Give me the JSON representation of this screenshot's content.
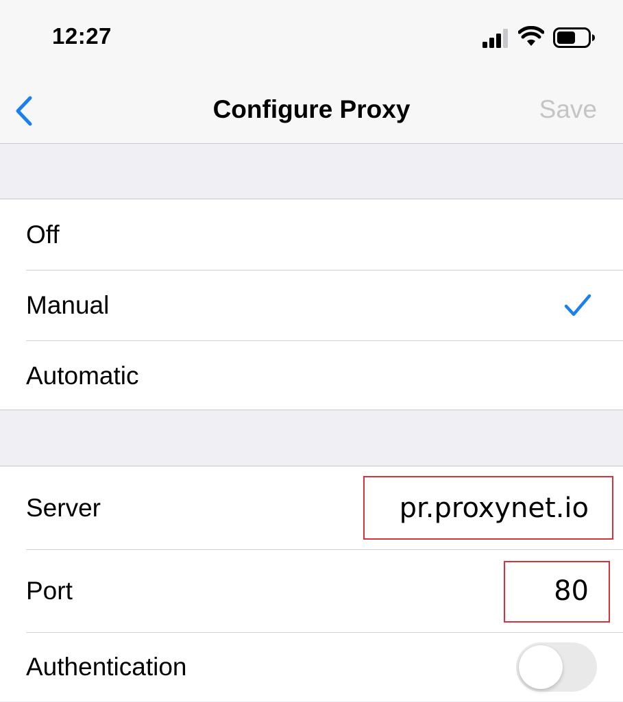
{
  "status_bar": {
    "time": "12:27",
    "icons": [
      "cellular-signal-icon",
      "wifi-icon",
      "battery-icon"
    ]
  },
  "nav": {
    "back_icon": "chevron-left-icon",
    "title": "Configure Proxy",
    "save_label": "Save"
  },
  "proxy_modes": {
    "options": [
      {
        "label": "Off",
        "selected": false
      },
      {
        "label": "Manual",
        "selected": true
      },
      {
        "label": "Automatic",
        "selected": false
      }
    ],
    "check_icon": "checkmark-icon"
  },
  "manual_settings": {
    "server": {
      "label": "Server",
      "value": "pr.proxynet.io"
    },
    "port": {
      "label": "Port",
      "value": "80"
    },
    "authentication": {
      "label": "Authentication",
      "enabled": false
    }
  },
  "colors": {
    "accent": "#1a7ff0",
    "highlight_box": "#d9313c",
    "disabled_text": "#c4c4c7",
    "group_background": "#efeff4"
  }
}
